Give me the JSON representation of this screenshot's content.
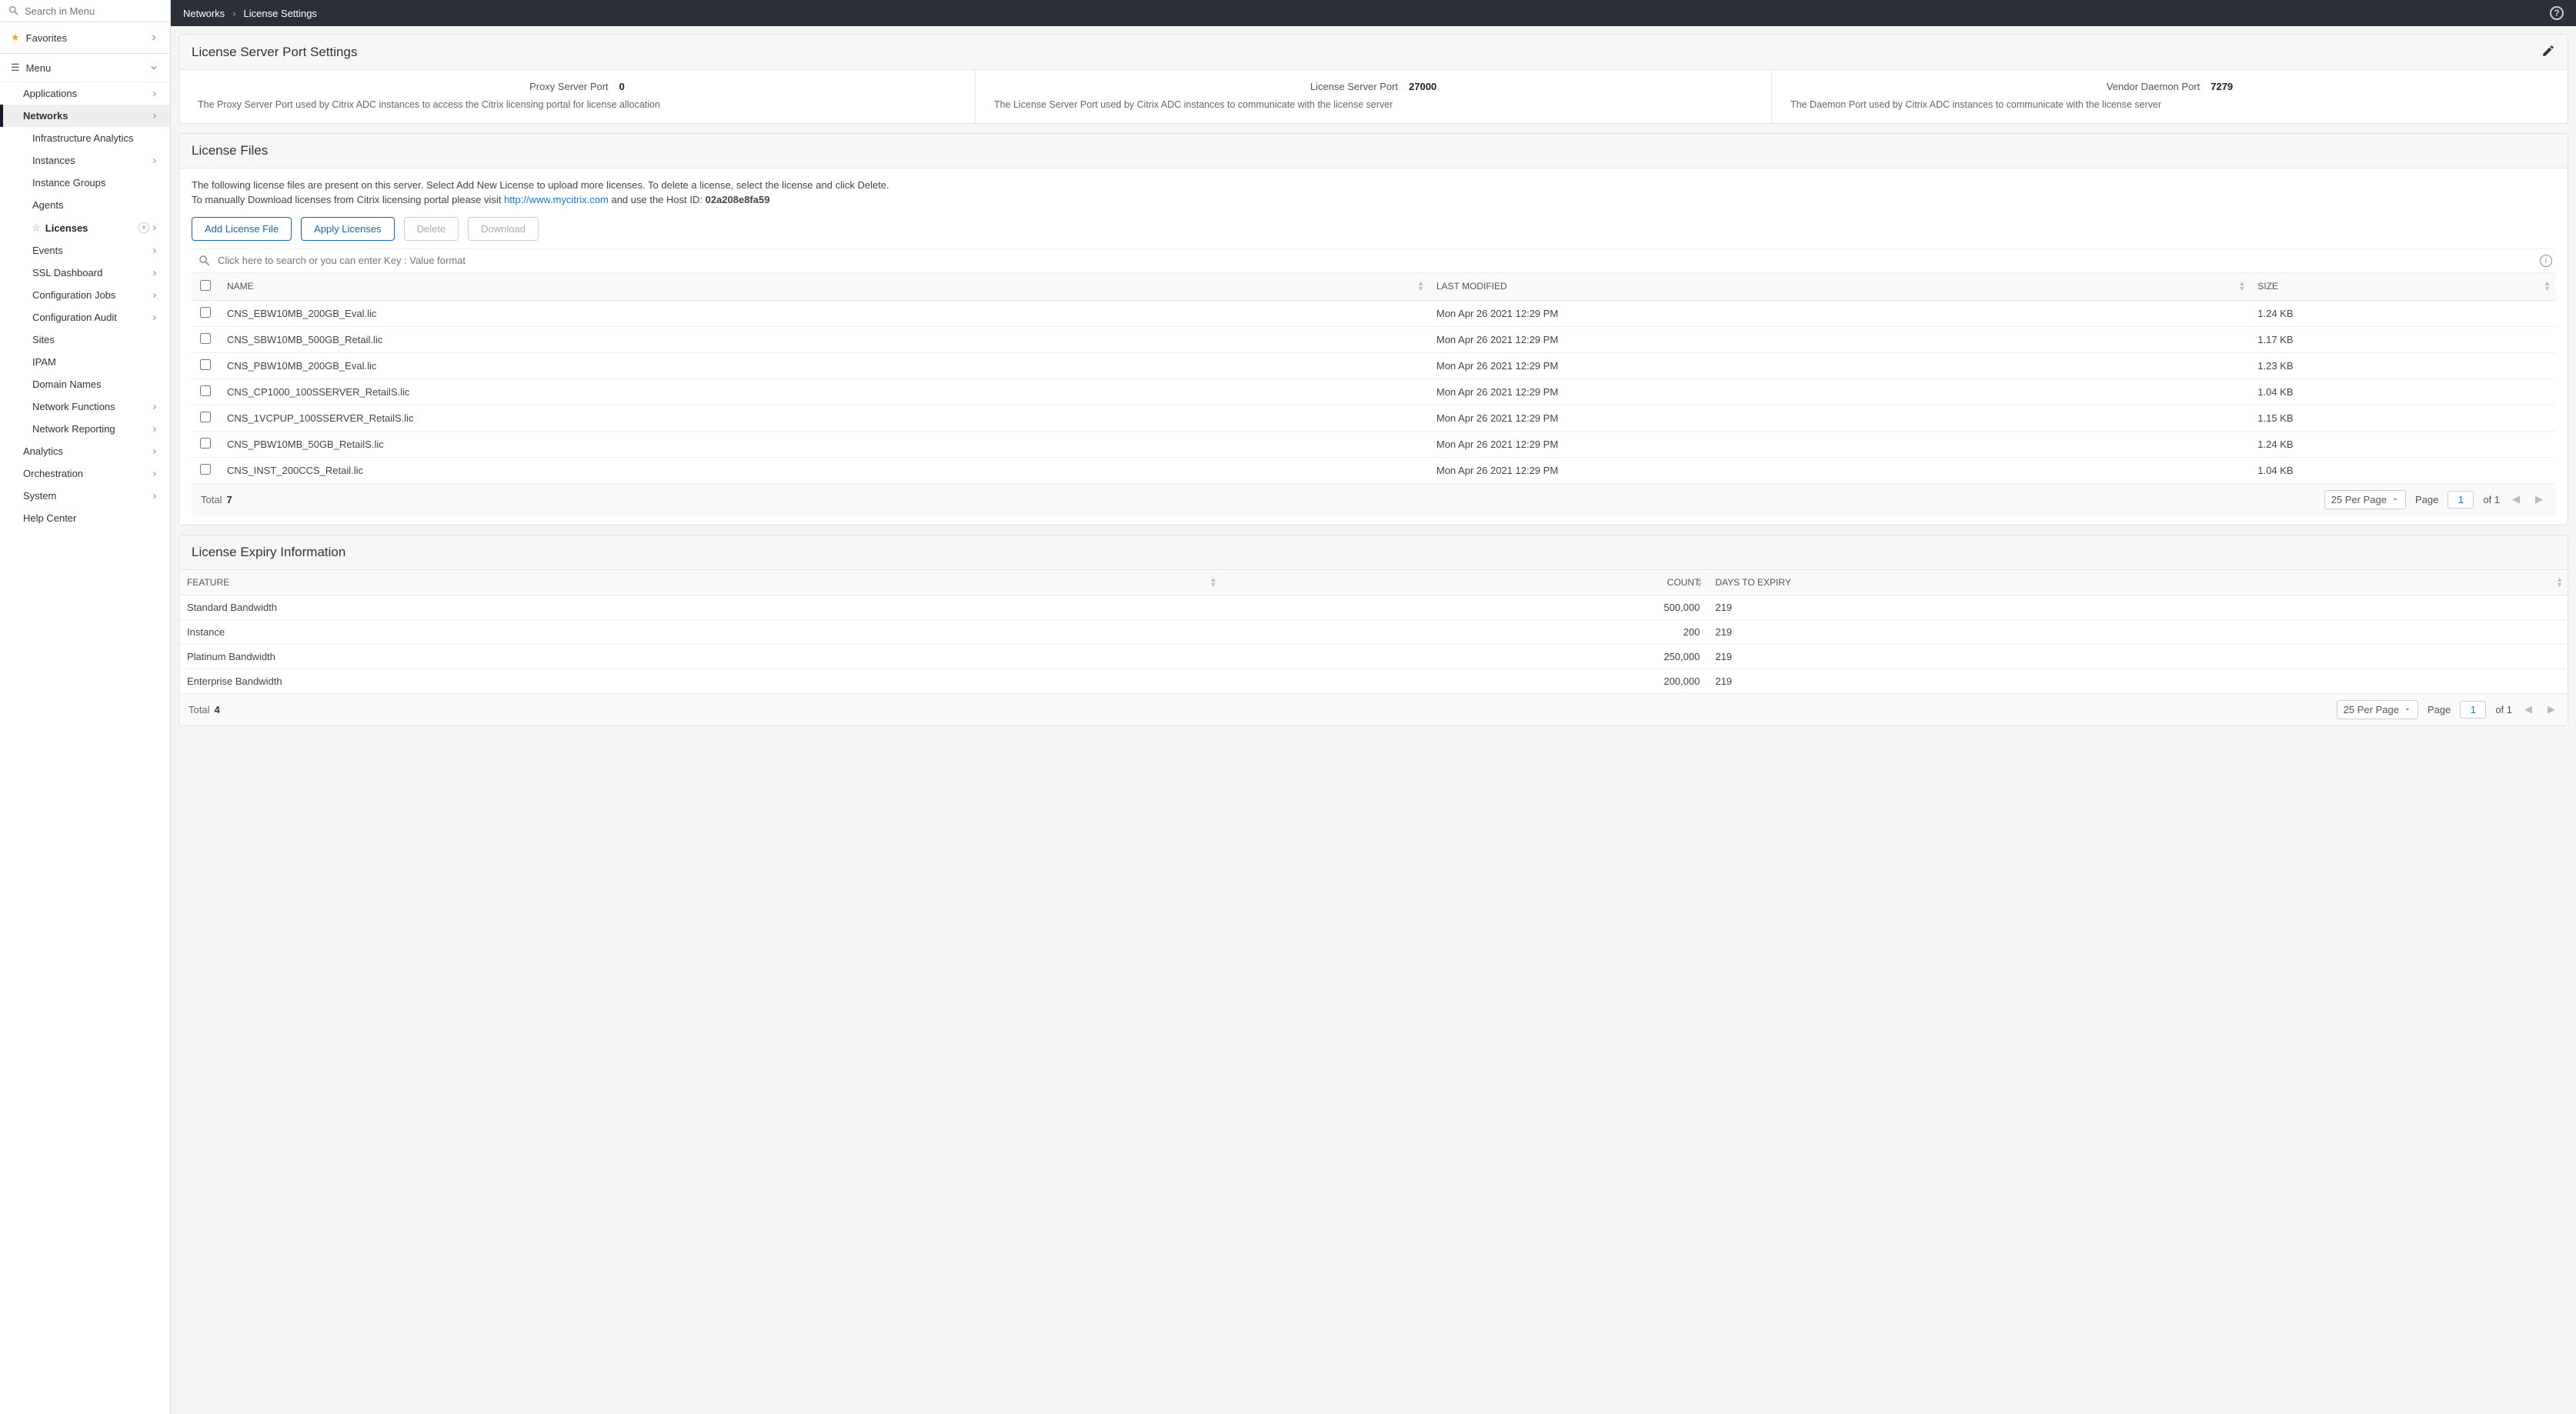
{
  "search_placeholder": "Search in Menu",
  "favorites_label": "Favorites",
  "menu_label": "Menu",
  "sidebar": {
    "top_items": [
      {
        "label": "Applications",
        "chev": true
      },
      {
        "label": "Networks",
        "chev": true,
        "active": true
      }
    ],
    "network_items": [
      {
        "label": "Infrastructure Analytics"
      },
      {
        "label": "Instances",
        "chev": true
      },
      {
        "label": "Instance Groups"
      },
      {
        "label": "Agents"
      },
      {
        "label": "Licenses",
        "selected": true,
        "chev": true,
        "star": true,
        "home": true
      },
      {
        "label": "Events",
        "chev": true
      },
      {
        "label": "SSL Dashboard",
        "chev": true
      },
      {
        "label": "Configuration Jobs",
        "chev": true
      },
      {
        "label": "Configuration Audit",
        "chev": true
      },
      {
        "label": "Sites"
      },
      {
        "label": "IPAM"
      },
      {
        "label": "Domain Names"
      },
      {
        "label": "Network Functions",
        "chev": true
      },
      {
        "label": "Network Reporting",
        "chev": true
      }
    ],
    "bottom_items": [
      {
        "label": "Analytics",
        "chev": true
      },
      {
        "label": "Orchestration",
        "chev": true
      },
      {
        "label": "System",
        "chev": true
      },
      {
        "label": "Help Center"
      }
    ]
  },
  "breadcrumb": [
    "Networks",
    "License Settings"
  ],
  "port_settings": {
    "title": "License Server Port Settings",
    "cells": [
      {
        "label": "Proxy Server Port",
        "value": "0",
        "desc": "The Proxy Server Port used by Citrix ADC instances to access the Citrix licensing portal for license allocation"
      },
      {
        "label": "License Server Port",
        "value": "27000",
        "desc": "The License Server Port used by Citrix ADC instances to communicate with the license server"
      },
      {
        "label": "Vendor Daemon Port",
        "value": "7279",
        "desc": "The Daemon Port used by Citrix ADC instances to communicate with the license server"
      }
    ]
  },
  "license_files": {
    "title": "License Files",
    "note_pre": "The following license files are present on this server. Select Add New License to upload more licenses. To delete a license, select the license and click Delete.",
    "note_manual": "To manually Download licenses from Citrix licensing portal please visit ",
    "link": "http://www.mycitrix.com",
    "note_host": " and use the Host ID: ",
    "host_id": "02a208e8fa59",
    "buttons": {
      "add": "Add License File",
      "apply": "Apply Licenses",
      "delete": "Delete",
      "download": "Download"
    },
    "search_placeholder": "Click here to search or you can enter Key : Value format",
    "columns": [
      "NAME",
      "LAST MODIFIED",
      "SIZE"
    ],
    "rows": [
      {
        "name": "CNS_EBW10MB_200GB_Eval.lic",
        "modified": "Mon Apr 26 2021 12:29 PM",
        "size": "1.24 KB"
      },
      {
        "name": "CNS_SBW10MB_500GB_Retail.lic",
        "modified": "Mon Apr 26 2021 12:29 PM",
        "size": "1.17 KB"
      },
      {
        "name": "CNS_PBW10MB_200GB_Eval.lic",
        "modified": "Mon Apr 26 2021 12:29 PM",
        "size": "1.23 KB"
      },
      {
        "name": "CNS_CP1000_100SSERVER_RetailS.lic",
        "modified": "Mon Apr 26 2021 12:29 PM",
        "size": "1.04 KB"
      },
      {
        "name": "CNS_1VCPUP_100SSERVER_RetailS.lic",
        "modified": "Mon Apr 26 2021 12:29 PM",
        "size": "1.15 KB"
      },
      {
        "name": "CNS_PBW10MB_50GB_RetailS.lic",
        "modified": "Mon Apr 26 2021 12:29 PM",
        "size": "1.24 KB"
      },
      {
        "name": "CNS_INST_200CCS_Retail.lic",
        "modified": "Mon Apr 26 2021 12:29 PM",
        "size": "1.04 KB"
      }
    ],
    "total_label": "Total",
    "total": "7",
    "per_page": "25 Per Page",
    "page_label": "Page",
    "page": "1",
    "of_label": "of 1"
  },
  "expiry": {
    "title": "License Expiry Information",
    "columns": [
      "FEATURE",
      "COUNT",
      "DAYS TO EXPIRY"
    ],
    "rows": [
      {
        "feature": "Standard Bandwidth",
        "count": "500,000",
        "days": "219"
      },
      {
        "feature": "Instance",
        "count": "200",
        "days": "219"
      },
      {
        "feature": "Platinum Bandwidth",
        "count": "250,000",
        "days": "219"
      },
      {
        "feature": "Enterprise Bandwidth",
        "count": "200,000",
        "days": "219"
      }
    ],
    "total_label": "Total",
    "total": "4",
    "per_page": "25 Per Page",
    "page_label": "Page",
    "page": "1",
    "of_label": "of 1"
  }
}
